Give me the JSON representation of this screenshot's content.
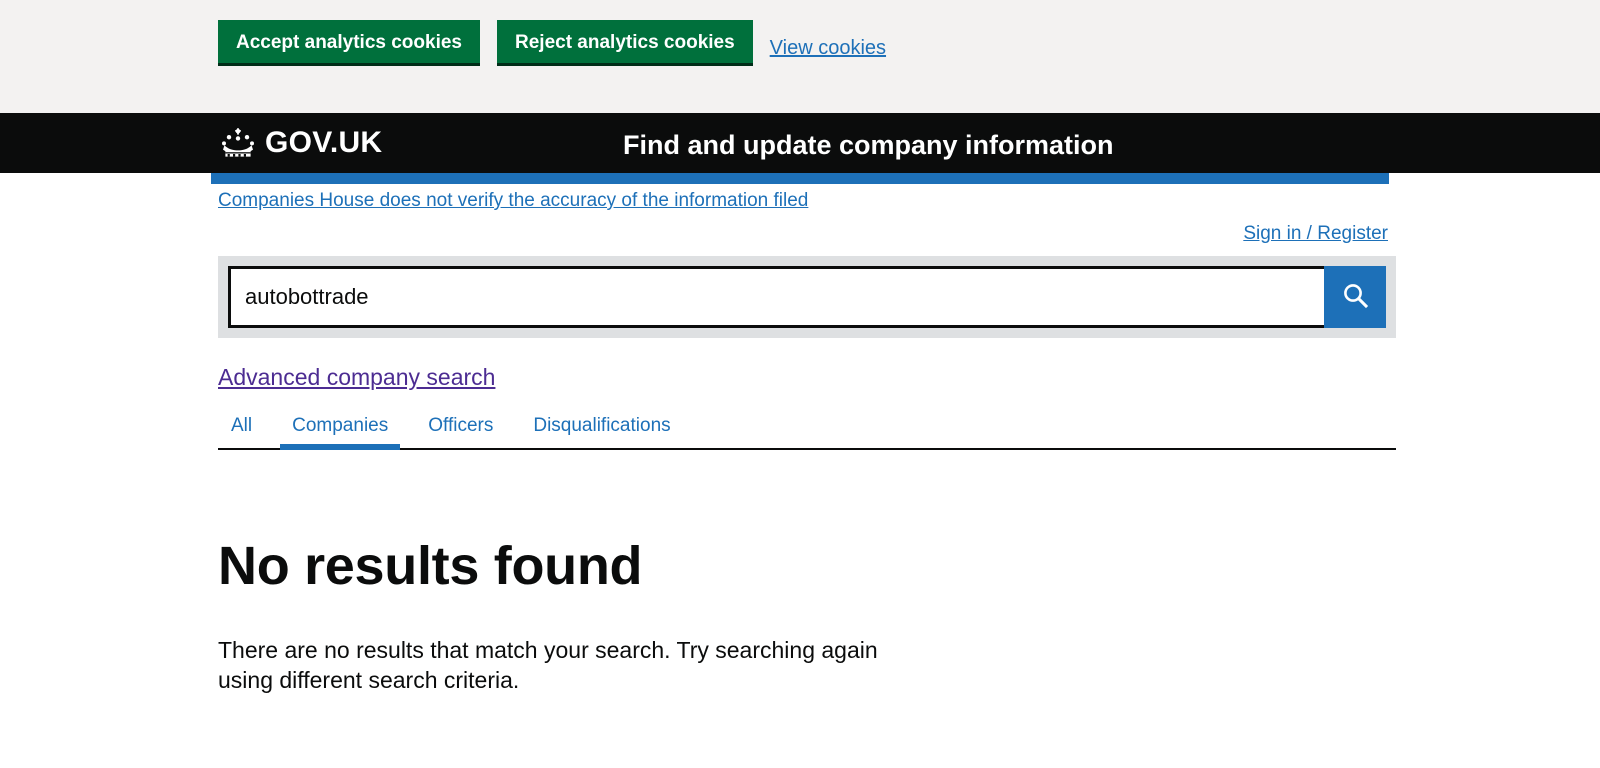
{
  "cookie_banner": {
    "clipped_text_above": "",
    "accept_label": "Accept analytics cookies",
    "reject_label": "Reject analytics cookies",
    "view_cookies_label": "View cookies"
  },
  "header": {
    "brand": "GOV.UK",
    "crown_icon": "crown-icon",
    "service_name": "Find and update company information",
    "stripe_color": "#1d70b8",
    "background_color": "#0b0c0c"
  },
  "phase_banner": {
    "link_label": "Companies House does not verify the accuracy of the information filed"
  },
  "account": {
    "sign_in_label": "Sign in / Register"
  },
  "search": {
    "value": "autobottrade",
    "placeholder": "Search",
    "button_icon": "search-icon",
    "button_color": "#1d70b8"
  },
  "links": {
    "advanced_search_label": "Advanced company search",
    "advanced_search_color": "#4c2c92"
  },
  "tabs": {
    "active_index": 1,
    "items": [
      {
        "label": "All"
      },
      {
        "label": "Companies"
      },
      {
        "label": "Officers"
      },
      {
        "label": "Disqualifications"
      }
    ]
  },
  "results": {
    "heading": "No results found",
    "body": "There are no results that match your search. Try searching again using different search criteria."
  },
  "colors": {
    "green_button": "#00703c",
    "link_blue": "#1d70b8",
    "text": "#0b0c0c",
    "banner_grey": "#f3f2f1",
    "search_surround_grey": "#dee0e2"
  }
}
